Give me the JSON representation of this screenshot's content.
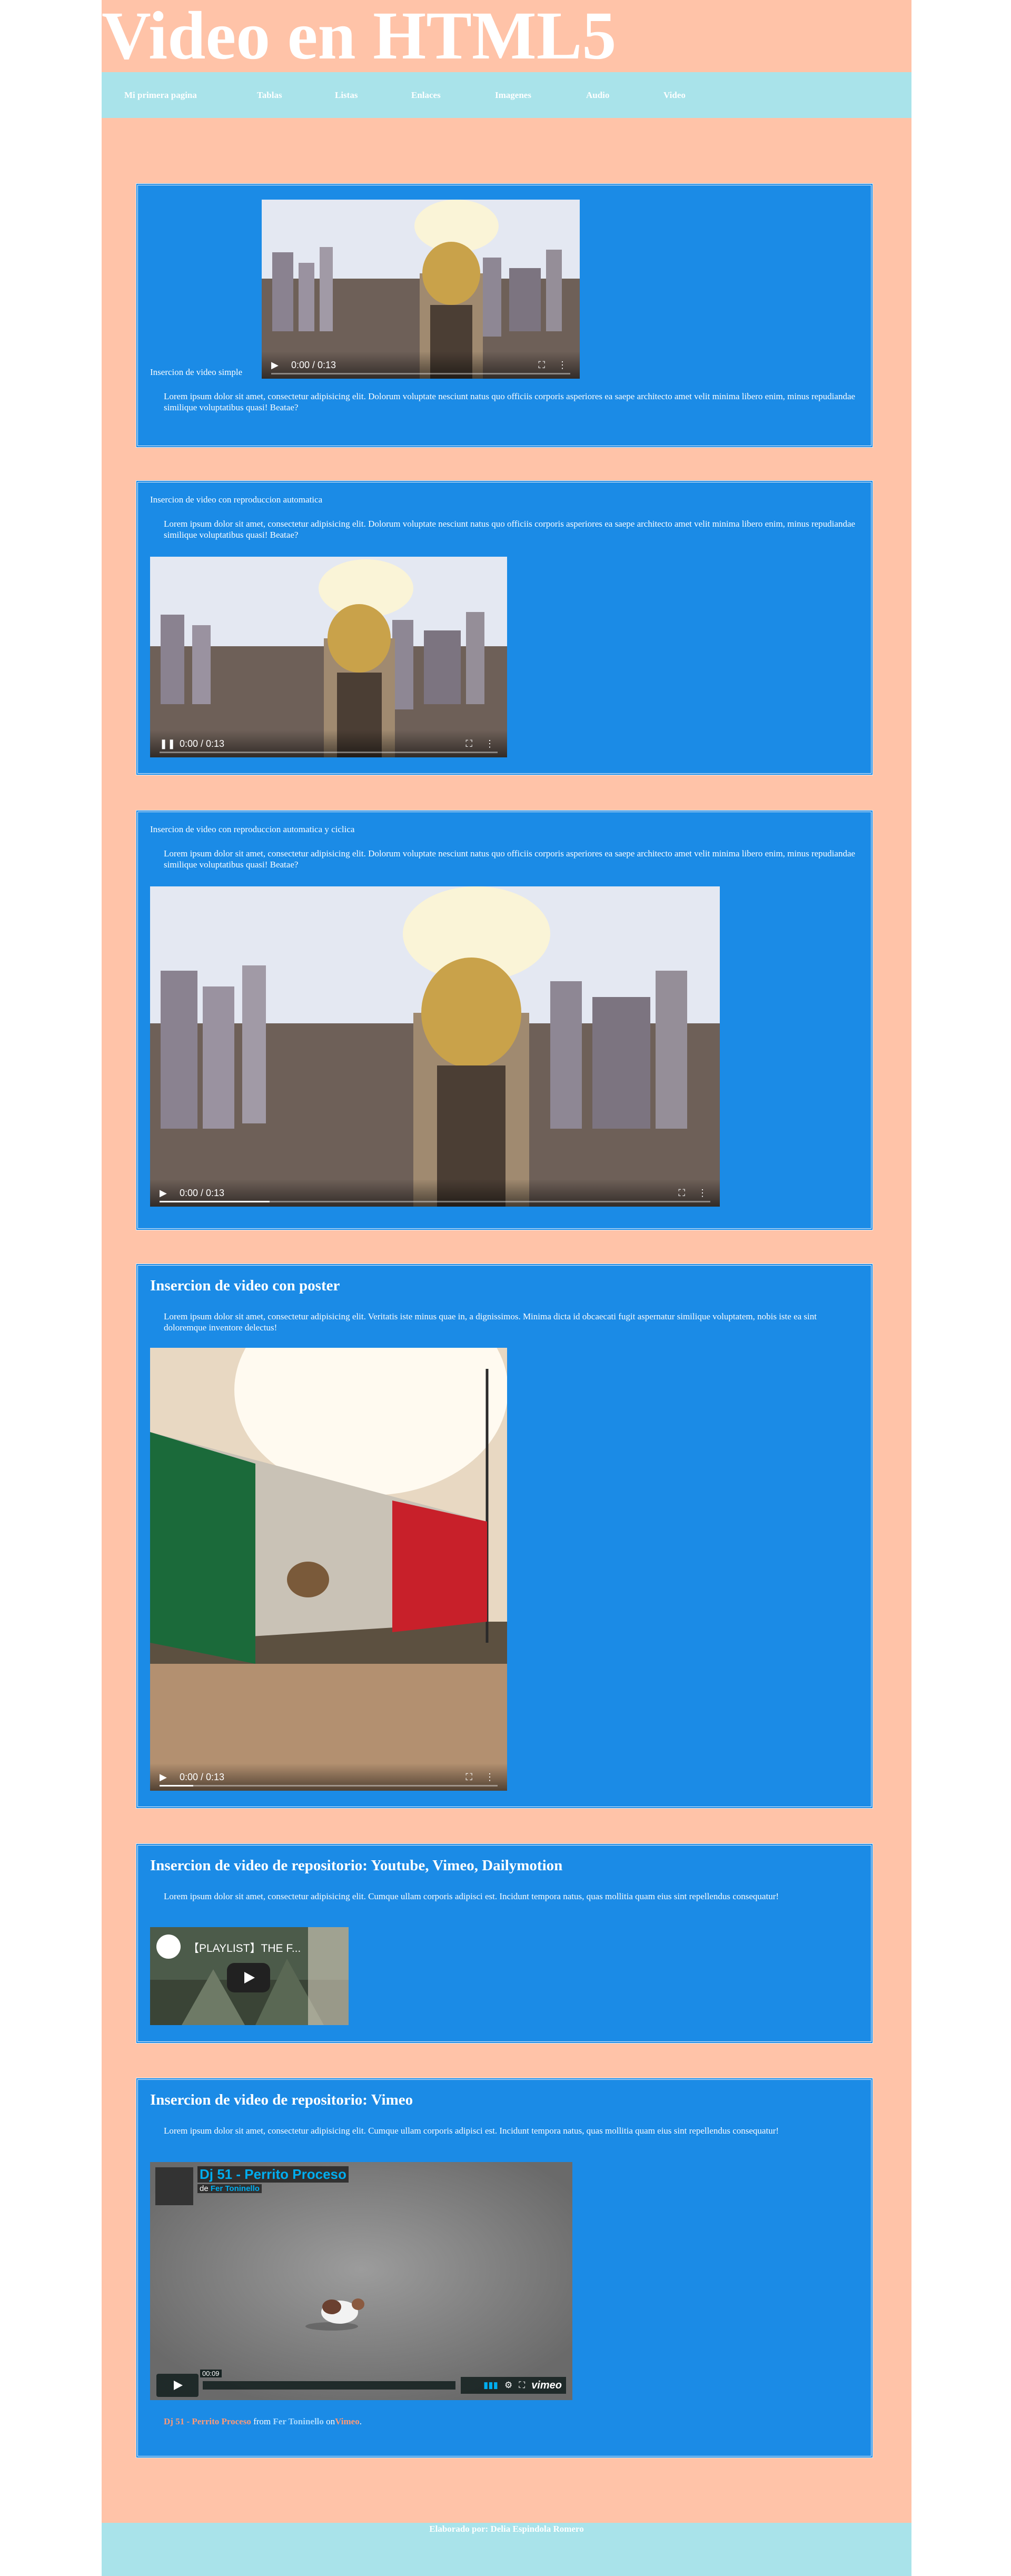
{
  "page": {
    "title": "Video en HTML5",
    "footer": "Elaborado por: Delia Espindola Romero"
  },
  "nav": {
    "items": [
      {
        "label": "Mi primera pagina"
      },
      {
        "label": "Tablas"
      },
      {
        "label": "Listas"
      },
      {
        "label": "Enlaces"
      },
      {
        "label": "Imagenes"
      },
      {
        "label": "Audio"
      },
      {
        "label": "Video"
      }
    ]
  },
  "sections": {
    "simple": {
      "title": "Insercion de video simple",
      "text": "Lorem ipsum dolor sit amet, consectetur adipisicing elit. Dolorum voluptate nesciunt natus quo officiis corporis asperiores ea saepe architecto amet velit minima libero enim, minus repudiandae similique voluptatibus quasi! Beatae?",
      "video_time": "0:00 / 0:13"
    },
    "autoplay": {
      "title": "Insercion de video con reproduccion automatica",
      "text": "Lorem ipsum dolor sit amet, consectetur adipisicing elit. Dolorum voluptate nesciunt natus quo officiis corporis asperiores ea saepe architecto amet velit minima libero enim, minus repudiandae similique voluptatibus quasi! Beatae?",
      "video_time": "0:00 / 0:13"
    },
    "loop": {
      "title": "Insercion de video con reproduccion automatica y ciclica",
      "text": "Lorem ipsum dolor sit amet, consectetur adipisicing elit. Dolorum voluptate nesciunt natus quo officiis corporis asperiores ea saepe architecto amet velit minima libero enim, minus repudiandae similique voluptatibus quasi! Beatae?",
      "video_time": "0:00 / 0:13"
    },
    "poster": {
      "title": "Insercion de video con poster",
      "text": "Lorem ipsum dolor sit amet, consectetur adipisicing elit. Veritatis iste minus quae in, a dignissimos. Minima dicta id obcaecati fugit aspernatur similique voluptatem, nobis iste ea sint doloremque inventore delectus!",
      "video_time": "0:00 / 0:13"
    },
    "repo": {
      "title": "Insercion de video de repositorio: Youtube, Vimeo, Dailymotion",
      "text": "Lorem ipsum dolor sit amet, consectetur adipisicing elit. Cumque ullam corporis adipisci est. Incidunt tempora natus, quas mollitia quam eius sint repellendus consequatur!",
      "youtube_title": "【PLAYLIST】THE F..."
    },
    "vimeo": {
      "title": "Insercion de video de repositorio: Vimeo",
      "text": "Lorem ipsum dolor sit amet, consectetur adipisicing elit. Cumque ullam corporis adipisci est. Incidunt tempora natus, quas mollitia quam eius sint repellendus consequatur!",
      "player_title": "Dj 51 - Perrito Proceso",
      "player_by_prefix": "de",
      "player_by": "Fer Toninello",
      "player_time": "00:09",
      "caption_video": "Dj 51 - Perrito Proceso",
      "caption_from": "from",
      "caption_user": "Fer Toninello",
      "caption_on": "on",
      "caption_site": "Vimeo",
      "caption_end": ".",
      "vimeo_logo": "vimeo"
    }
  }
}
